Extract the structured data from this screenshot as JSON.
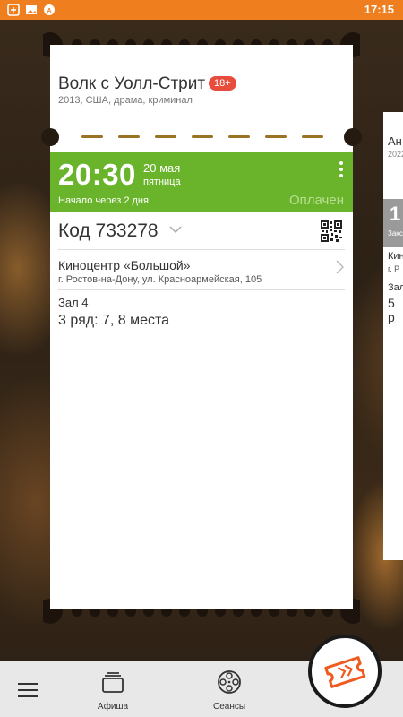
{
  "status_bar": {
    "time": "17:15"
  },
  "ticket": {
    "movie_title": "Волк с Уолл-Стрит",
    "age_rating": "18+",
    "movie_info": "2013, США, драма, криминал",
    "time": "20:30",
    "date": "20 мая",
    "weekday": "пятница",
    "starts_in": "Начало через 2 дня",
    "payment_status": "Оплачен",
    "code": "Код 733278",
    "cinema_name": "Киноцентр «Большой»",
    "cinema_address": "г. Ростов-на-Дону, ул. Красноармейская, 105",
    "hall": "Зал 4",
    "seats": "3 ряд: 7, 8 места"
  },
  "next_ticket_partial": {
    "title_fragment": "Ан",
    "info_fragment": "2022",
    "time_fragment": "1",
    "status_fragment": "Закс",
    "cinema_fragment": "Кин",
    "address_fragment": "г. Р",
    "hall_fragment": "Зал",
    "seats_fragment": "5 р"
  },
  "bottom_nav": {
    "items": [
      {
        "label": "Афиша",
        "icon": "box-icon"
      },
      {
        "label": "Сеансы",
        "icon": "film-reel-icon"
      }
    ]
  },
  "colors": {
    "accent": "#ef7e1f",
    "paid_green": "#6ab42c",
    "age_badge": "#e74c3c"
  }
}
